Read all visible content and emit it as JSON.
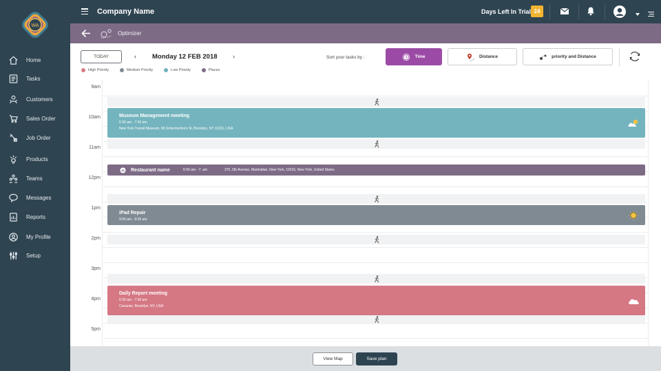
{
  "header": {
    "company": "Company Name",
    "trial_label": "Days Left In Trial",
    "trial_days": "24"
  },
  "subheader": {
    "title": "Optimizer"
  },
  "sidebar": {
    "items": [
      {
        "label": "Home",
        "icon": "home-icon"
      },
      {
        "label": "Tasks",
        "icon": "tasks-icon"
      },
      {
        "label": "Customers",
        "icon": "customers-icon"
      },
      {
        "label": "Sales Order",
        "icon": "sales-order-icon"
      },
      {
        "label": "Job Order",
        "icon": "job-order-icon"
      },
      {
        "label": "Products",
        "icon": "products-icon"
      },
      {
        "label": "Teams",
        "icon": "teams-icon"
      },
      {
        "label": "Messages",
        "icon": "messages-icon"
      },
      {
        "label": "Reports",
        "icon": "reports-icon"
      },
      {
        "label": "My Profile",
        "icon": "profile-icon"
      },
      {
        "label": "Setup",
        "icon": "setup-icon"
      }
    ]
  },
  "toolbar": {
    "today": "TODAY",
    "date": "Monday  12  FEB 2018",
    "sort_label": "Sort your tasks by :",
    "sort_options": [
      {
        "label": "Time",
        "active": true
      },
      {
        "label": "Distance",
        "active": false
      },
      {
        "label": "priority and Distance",
        "active": false
      }
    ]
  },
  "legend": [
    {
      "label": "High Priority",
      "color": "#d77c87"
    },
    {
      "label": "Medium Priority",
      "color": "#7f8a93"
    },
    {
      "label": "Low Priority",
      "color": "#6fb3bd"
    },
    {
      "label": "Places",
      "color": "#7d6b86"
    }
  ],
  "calendar": {
    "hours": [
      "9am",
      "10am",
      "11am",
      "12pm",
      "1pm",
      "2pm",
      "3pm",
      "4pm",
      "5pm"
    ],
    "events": [
      {
        "title": "Museum Management meeting",
        "time": "6:30 am - 7:30 am",
        "address": "New York Transit Museum, 99 Schermerhorn St, Brooklyn, NY 11201, USA",
        "color": "#74b4be",
        "weather": "partly-cloudy-icon"
      },
      {
        "title": "iPad Repair",
        "time": "9:00 am - 9:30 am",
        "color": "#7f8a93",
        "weather": "sunny-icon"
      },
      {
        "title": "Daily Report meeting",
        "time": "6:30 am - 7:30 am",
        "address": "Canarsie, Brooklyn, NY, USA",
        "color": "#d57884",
        "weather": "cloudy-icon"
      }
    ],
    "place": {
      "title": "Restaurant name",
      "time": "6:00 am - 7: am",
      "address": "375, 5th Avenue, Manhattan, New York, 10016, New York, United States"
    }
  },
  "footer": {
    "view_map": "View Map",
    "save_plan": "Save plan"
  }
}
